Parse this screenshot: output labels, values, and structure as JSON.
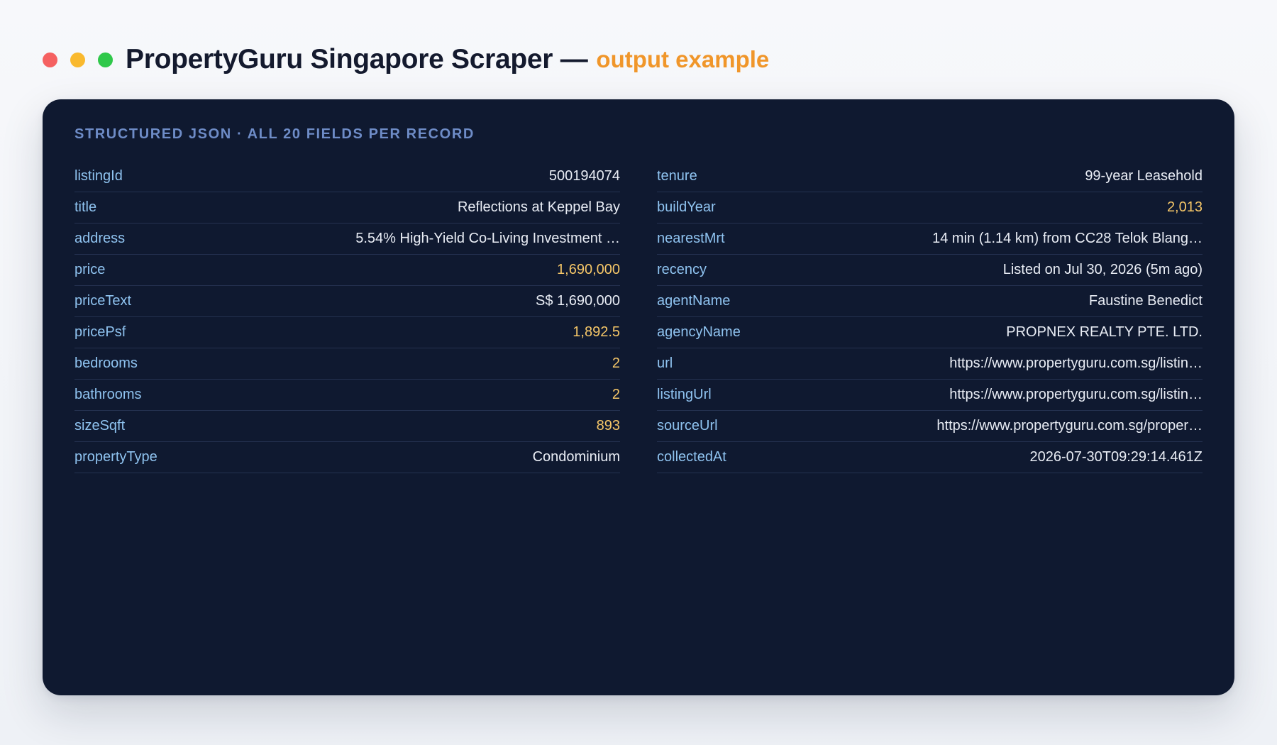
{
  "colors": {
    "dot_red": "#f56161",
    "dot_yellow": "#f9b92e",
    "dot_green": "#2fc84a",
    "subtitle": "#f0962a",
    "section_label": "#6e8cc7",
    "key": "#8fc3f0",
    "number": "#f6c768",
    "text_value": "#e9edf5",
    "card_bg": "#0f1930"
  },
  "header": {
    "window_controls": [
      "close-dot",
      "minimize-dot",
      "maximize-dot"
    ],
    "title": "PropertyGuru Singapore Scraper —",
    "subtitle": "output example"
  },
  "card": {
    "section_label": "STRUCTURED JSON · ALL 20 FIELDS PER RECORD",
    "left_fields": [
      {
        "key": "listingId",
        "value": "500194074",
        "kind": "text"
      },
      {
        "key": "title",
        "value": "Reflections at Keppel Bay",
        "kind": "text"
      },
      {
        "key": "address",
        "value": "5.54% High-Yield Co-Living Investment …",
        "kind": "text"
      },
      {
        "key": "price",
        "value": "1,690,000",
        "kind": "number"
      },
      {
        "key": "priceText",
        "value": "S$ 1,690,000",
        "kind": "text"
      },
      {
        "key": "pricePsf",
        "value": "1,892.5",
        "kind": "number"
      },
      {
        "key": "bedrooms",
        "value": "2",
        "kind": "number"
      },
      {
        "key": "bathrooms",
        "value": "2",
        "kind": "number"
      },
      {
        "key": "sizeSqft",
        "value": "893",
        "kind": "number"
      },
      {
        "key": "propertyType",
        "value": "Condominium",
        "kind": "text"
      }
    ],
    "right_fields": [
      {
        "key": "tenure",
        "value": "99-year Leasehold",
        "kind": "text"
      },
      {
        "key": "buildYear",
        "value": "2,013",
        "kind": "number"
      },
      {
        "key": "nearestMrt",
        "value": "14 min (1.14 km) from CC28 Telok Blang…",
        "kind": "text"
      },
      {
        "key": "recency",
        "value": "Listed on Jul 30, 2026 (5m ago)",
        "kind": "text"
      },
      {
        "key": "agentName",
        "value": "Faustine Benedict",
        "kind": "text"
      },
      {
        "key": "agencyName",
        "value": "PROPNEX REALTY PTE. LTD.",
        "kind": "text"
      },
      {
        "key": "url",
        "value": "https://www.propertyguru.com.sg/listin…",
        "kind": "text"
      },
      {
        "key": "listingUrl",
        "value": "https://www.propertyguru.com.sg/listin…",
        "kind": "text"
      },
      {
        "key": "sourceUrl",
        "value": "https://www.propertyguru.com.sg/proper…",
        "kind": "text"
      },
      {
        "key": "collectedAt",
        "value": "2026-07-30T09:29:14.461Z",
        "kind": "text"
      }
    ]
  }
}
